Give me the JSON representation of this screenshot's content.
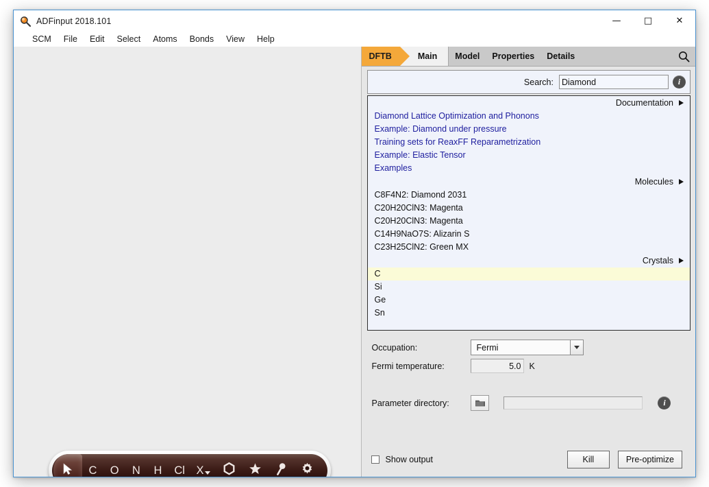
{
  "window": {
    "title": "ADFinput 2018.101",
    "icon": "magnifier-icon",
    "controls": {
      "minimize": "—",
      "maximize": "□",
      "close": "✕"
    }
  },
  "menubar": {
    "items": [
      "SCM",
      "File",
      "Edit",
      "Select",
      "Atoms",
      "Bonds",
      "View",
      "Help"
    ]
  },
  "tabs": {
    "engine": "DFTB",
    "active": "Main",
    "others": [
      "Model",
      "Properties",
      "Details"
    ],
    "search_icon": "magnifier-icon"
  },
  "search": {
    "label": "Search:",
    "value": "Diamond",
    "placeholder": "",
    "info_icon": "info-icon"
  },
  "results": {
    "sections": [
      {
        "header": "Documentation",
        "items": [
          {
            "text": "Diamond Lattice Optimization and Phonons",
            "style": "link",
            "selected": false
          },
          {
            "text": "Example: Diamond under pressure",
            "style": "link",
            "selected": false
          },
          {
            "text": "Training sets for ReaxFF Reparametrization",
            "style": "link",
            "selected": false
          },
          {
            "text": "Example: Elastic Tensor",
            "style": "link",
            "selected": false
          },
          {
            "text": "Examples",
            "style": "link",
            "selected": false
          }
        ]
      },
      {
        "header": "Molecules",
        "items": [
          {
            "text": "C8F4N2: Diamond 2031",
            "style": "plain",
            "selected": false
          },
          {
            "text": "C20H20ClN3: Magenta",
            "style": "plain",
            "selected": false
          },
          {
            "text": "C20H20ClN3: Magenta",
            "style": "plain",
            "selected": false
          },
          {
            "text": "C14H9NaO7S: Alizarin S",
            "style": "plain",
            "selected": false
          },
          {
            "text": "C23H25ClN2: Green MX",
            "style": "plain",
            "selected": false
          }
        ]
      },
      {
        "header": "Crystals",
        "items": [
          {
            "text": "C",
            "style": "plain",
            "selected": true
          },
          {
            "text": "Si",
            "style": "plain",
            "selected": false
          },
          {
            "text": "Ge",
            "style": "plain",
            "selected": false
          },
          {
            "text": "Sn",
            "style": "plain",
            "selected": false
          }
        ]
      }
    ]
  },
  "form": {
    "occupation_label": "Occupation:",
    "occupation_value": "Fermi",
    "fermi_label": "Fermi temperature:",
    "fermi_value": "5.0",
    "fermi_unit": "K",
    "dir_label": "Parameter directory:",
    "dir_value": "",
    "dir_browse_icon": "folder-icon",
    "dir_info_icon": "info-icon"
  },
  "bottom": {
    "show_output_label": "Show output",
    "show_output_checked": false,
    "kill_label": "Kill",
    "preoptimize_label": "Pre-optimize"
  },
  "mol_toolbar": {
    "tools": [
      {
        "name": "select-cursor",
        "label": "",
        "icon": "cursor-arrow-icon",
        "selected": true
      },
      {
        "name": "element-c",
        "label": "C",
        "icon": "",
        "selected": false
      },
      {
        "name": "element-o",
        "label": "O",
        "icon": "",
        "selected": false
      },
      {
        "name": "element-n",
        "label": "N",
        "icon": "",
        "selected": false
      },
      {
        "name": "element-h",
        "label": "H",
        "icon": "",
        "selected": false
      },
      {
        "name": "element-cl",
        "label": "Cl",
        "icon": "",
        "selected": false
      },
      {
        "name": "element-other",
        "label": "X",
        "icon": "caret-down-icon",
        "selected": false
      },
      {
        "name": "ring-tool",
        "label": "",
        "icon": "hexagon-icon",
        "selected": false
      },
      {
        "name": "favorite-tool",
        "label": "",
        "icon": "star-icon",
        "selected": false
      },
      {
        "name": "pin-tool",
        "label": "",
        "icon": "pin-icon",
        "selected": false
      },
      {
        "name": "settings-tool",
        "label": "",
        "icon": "gear-icon",
        "selected": false
      }
    ]
  },
  "colors": {
    "accent_orange": "#F4A83A",
    "tab_gray": "#C9C9C9",
    "list_bg": "#F0F3FB",
    "selection_yellow": "#FBFBD7",
    "link_blue": "#1D1D9E",
    "toolbar_brown": "#3B1B16",
    "window_border_blue": "#4A93D1"
  }
}
